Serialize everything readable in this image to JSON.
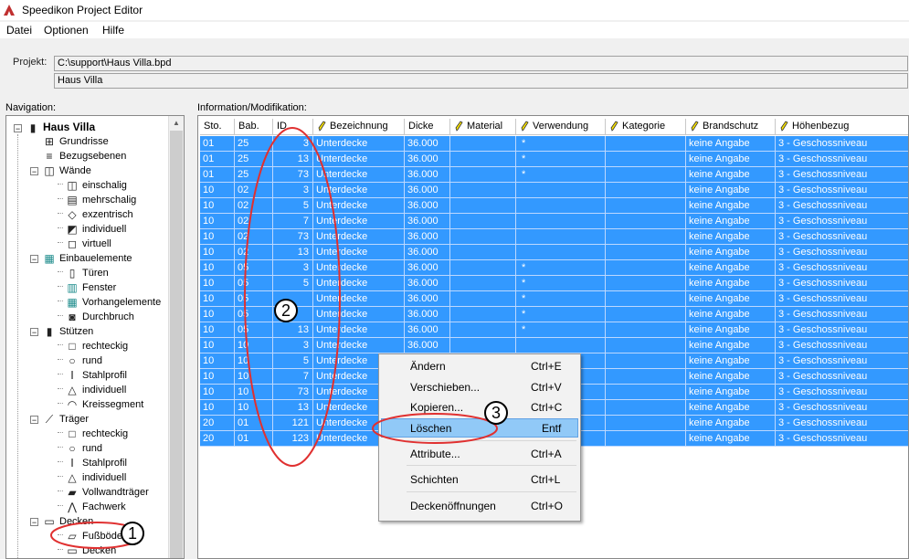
{
  "window": {
    "title": "Speedikon Project Editor"
  },
  "menu": [
    "Datei",
    "Optionen",
    "Hilfe"
  ],
  "project": {
    "label": "Projekt:",
    "path": "C:\\support\\Haus Villa.bpd",
    "name": "Haus Villa"
  },
  "navigation": {
    "label": "Navigation:",
    "tree": [
      {
        "label": "Haus Villa",
        "level": 0,
        "expanded": true,
        "icon": "building-icon",
        "bold": true
      },
      {
        "label": "Grundrisse",
        "level": 1,
        "icon": "floorplan-icon"
      },
      {
        "label": "Bezugsebenen",
        "level": 1,
        "icon": "levels-icon"
      },
      {
        "label": "Wände",
        "level": 1,
        "expanded": true,
        "icon": "wall-icon"
      },
      {
        "label": "einschalig",
        "level": 2,
        "icon": "wall-single-icon"
      },
      {
        "label": "mehrschalig",
        "level": 2,
        "icon": "wall-multi-icon"
      },
      {
        "label": "exzentrisch",
        "level": 2,
        "icon": "wall-eccentric-icon"
      },
      {
        "label": "individuell",
        "level": 2,
        "icon": "wall-custom-icon"
      },
      {
        "label": "virtuell",
        "level": 2,
        "icon": "wall-virtual-icon"
      },
      {
        "label": "Einbauelemente",
        "level": 1,
        "expanded": true,
        "icon": "elements-icon"
      },
      {
        "label": "Türen",
        "level": 2,
        "icon": "door-icon"
      },
      {
        "label": "Fenster",
        "level": 2,
        "icon": "window-icon"
      },
      {
        "label": "Vorhangelemente",
        "level": 2,
        "icon": "curtain-wall-icon"
      },
      {
        "label": "Durchbruch",
        "level": 2,
        "icon": "opening-icon"
      },
      {
        "label": "Stützen",
        "level": 1,
        "expanded": true,
        "icon": "column-icon"
      },
      {
        "label": "rechteckig",
        "level": 2,
        "icon": "rectangle-icon"
      },
      {
        "label": "rund",
        "level": 2,
        "icon": "circle-icon"
      },
      {
        "label": "Stahlprofil",
        "level": 2,
        "icon": "steel-profile-icon"
      },
      {
        "label": "individuell",
        "level": 2,
        "icon": "custom-shape-icon"
      },
      {
        "label": "Kreissegment",
        "level": 2,
        "icon": "circle-segment-icon"
      },
      {
        "label": "Träger",
        "level": 1,
        "expanded": true,
        "icon": "beam-icon"
      },
      {
        "label": "rechteckig",
        "level": 2,
        "icon": "rectangle-icon"
      },
      {
        "label": "rund",
        "level": 2,
        "icon": "circle-icon"
      },
      {
        "label": "Stahlprofil",
        "level": 2,
        "icon": "steel-profile-icon"
      },
      {
        "label": "individuell",
        "level": 2,
        "icon": "custom-shape-icon"
      },
      {
        "label": "Vollwandträger",
        "level": 2,
        "icon": "plate-girder-icon"
      },
      {
        "label": "Fachwerk",
        "level": 2,
        "icon": "truss-icon"
      },
      {
        "label": "Decken",
        "level": 1,
        "expanded": true,
        "icon": "slab-icon"
      },
      {
        "label": "Fußböden",
        "level": 2,
        "icon": "floor-icon"
      },
      {
        "label": "Decken",
        "level": 2,
        "icon": "ceiling-icon"
      }
    ]
  },
  "info": {
    "label": "Information/Modifikation:",
    "columns": [
      {
        "label": "Sto.",
        "editable": false
      },
      {
        "label": "Bab.",
        "editable": false
      },
      {
        "label": "ID",
        "editable": false
      },
      {
        "label": "Bezeichnung",
        "editable": true
      },
      {
        "label": "Dicke",
        "editable": false
      },
      {
        "label": "Material",
        "editable": true
      },
      {
        "label": "Verwendung",
        "editable": true
      },
      {
        "label": "Kategorie",
        "editable": true
      },
      {
        "label": "Brandschutz",
        "editable": true
      },
      {
        "label": "Höhenbezug",
        "editable": true
      }
    ],
    "rows": [
      [
        "01",
        "25",
        "3",
        "Unterdecke",
        "36.000",
        "",
        "*",
        "",
        "keine Angabe",
        "3 - Geschossniveau"
      ],
      [
        "01",
        "25",
        "13",
        "Unterdecke",
        "36.000",
        "",
        "*",
        "",
        "keine Angabe",
        "3 - Geschossniveau"
      ],
      [
        "01",
        "25",
        "73",
        "Unterdecke",
        "36.000",
        "",
        "*",
        "",
        "keine Angabe",
        "3 - Geschossniveau"
      ],
      [
        "10",
        "02",
        "3",
        "Unterdecke",
        "36.000",
        "",
        "",
        "",
        "keine Angabe",
        "3 - Geschossniveau"
      ],
      [
        "10",
        "02",
        "5",
        "Unterdecke",
        "36.000",
        "",
        "",
        "",
        "keine Angabe",
        "3 - Geschossniveau"
      ],
      [
        "10",
        "02",
        "7",
        "Unterdecke",
        "36.000",
        "",
        "",
        "",
        "keine Angabe",
        "3 - Geschossniveau"
      ],
      [
        "10",
        "02",
        "73",
        "Unterdecke",
        "36.000",
        "",
        "",
        "",
        "keine Angabe",
        "3 - Geschossniveau"
      ],
      [
        "10",
        "02",
        "13",
        "Unterdecke",
        "36.000",
        "",
        "",
        "",
        "keine Angabe",
        "3 - Geschossniveau"
      ],
      [
        "10",
        "05",
        "3",
        "Unterdecke",
        "36.000",
        "",
        "*",
        "",
        "keine Angabe",
        "3 - Geschossniveau"
      ],
      [
        "10",
        "05",
        "5",
        "Unterdecke",
        "36.000",
        "",
        "*",
        "",
        "keine Angabe",
        "3 - Geschossniveau"
      ],
      [
        "10",
        "05",
        "",
        "Unterdecke",
        "36.000",
        "",
        "*",
        "",
        "keine Angabe",
        "3 - Geschossniveau"
      ],
      [
        "10",
        "05",
        "",
        "Unterdecke",
        "36.000",
        "",
        "*",
        "",
        "keine Angabe",
        "3 - Geschossniveau"
      ],
      [
        "10",
        "05",
        "13",
        "Unterdecke",
        "36.000",
        "",
        "*",
        "",
        "keine Angabe",
        "3 - Geschossniveau"
      ],
      [
        "10",
        "10",
        "3",
        "Unterdecke",
        "36.000",
        "",
        "",
        "",
        "keine Angabe",
        "3 - Geschossniveau"
      ],
      [
        "10",
        "10",
        "5",
        "Unterdecke",
        "",
        "",
        "",
        "",
        "keine Angabe",
        "3 - Geschossniveau"
      ],
      [
        "10",
        "10",
        "7",
        "Unterdecke",
        "",
        "",
        "",
        "",
        "keine Angabe",
        "3 - Geschossniveau"
      ],
      [
        "10",
        "10",
        "73",
        "Unterdecke",
        "",
        "",
        "",
        "",
        "keine Angabe",
        "3 - Geschossniveau"
      ],
      [
        "10",
        "10",
        "13",
        "Unterdecke",
        "",
        "",
        "",
        "",
        "keine Angabe",
        "3 - Geschossniveau"
      ],
      [
        "20",
        "01",
        "121",
        "Unterdecke",
        "",
        "",
        "",
        "",
        "keine Angabe",
        "3 - Geschossniveau"
      ],
      [
        "20",
        "01",
        "123",
        "Unterdecke",
        "",
        "",
        "",
        "",
        "keine Angabe",
        "3 - Geschossniveau"
      ]
    ]
  },
  "context_menu": {
    "items": [
      {
        "label": "Ändern",
        "shortcut": "Ctrl+E"
      },
      {
        "label": "Verschieben...",
        "shortcut": "Ctrl+V"
      },
      {
        "label": "Kopieren...",
        "shortcut": "Ctrl+C"
      },
      {
        "label": "Löschen",
        "shortcut": "Entf",
        "highlighted": true
      },
      {
        "label": "Attribute...",
        "shortcut": "Ctrl+A"
      },
      {
        "label": "Schichten",
        "shortcut": "Ctrl+L"
      },
      {
        "label": "Deckenöffnungen",
        "shortcut": "Ctrl+O"
      }
    ]
  },
  "annotations": [
    "1",
    "2",
    "3"
  ],
  "colors": {
    "selection": "#3399ff",
    "menu_highlight": "#91c9f7",
    "annotation": "#e03030"
  }
}
